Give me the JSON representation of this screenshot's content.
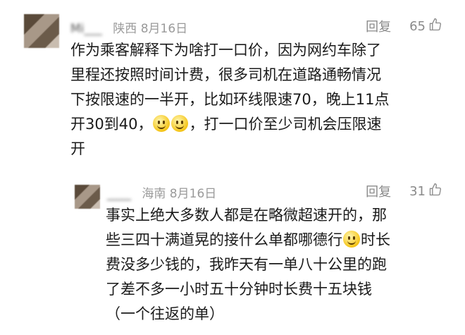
{
  "comments": [
    {
      "username": "Mi___",
      "location_date": "陕西 8月16日",
      "reply_label": "回复",
      "likes": "65",
      "text_lines": [
        "作为乘客解释下为啥打一口价，因为网约车除了",
        "里程还按照时间计费，很多司机在道路通畅情况",
        "下按限速的一半开，比如环线限速70，晚上11点",
        "开30到40，",
        "，打一口价至少司机会压限速",
        "开"
      ],
      "emojis": [
        "smile-emoji",
        "smile-emoji"
      ]
    },
    {
      "username": "____",
      "location_date": "海南 8月16日",
      "reply_label": "回复",
      "likes": "31",
      "text_lines": [
        "事实上绝大多数人都是在略微超速开的，那",
        "些三四十满道晃的接什么单都哪德行",
        "时长",
        "费没多少钱的，我昨天有一单八十公里的跑",
        "了差不多一小时五十分钟时长费十五块钱",
        "（一个往返的单）"
      ],
      "emojis": [
        "sweat-emoji"
      ]
    }
  ]
}
